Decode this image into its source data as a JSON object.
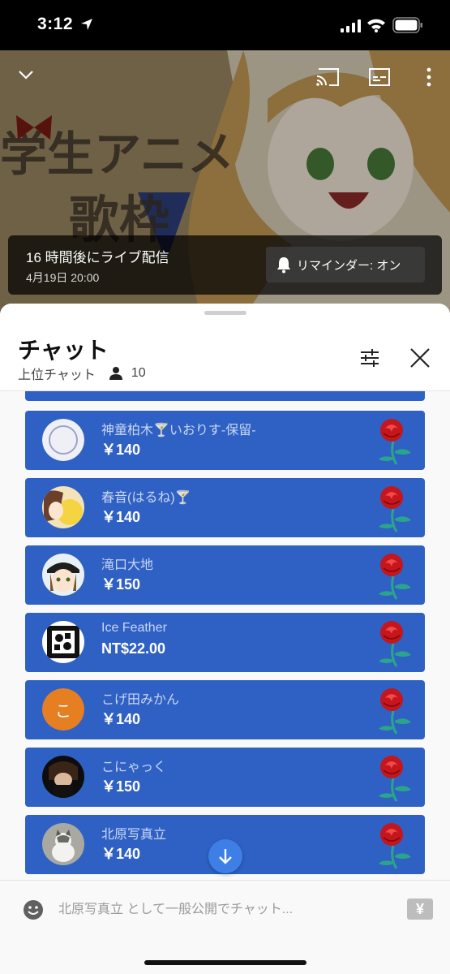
{
  "status_bar": {
    "time": "3:12"
  },
  "video": {
    "live_title": "16 時間後にライブ配信",
    "live_date": "4月19日 20:00",
    "reminder_label": "リマインダー: オン"
  },
  "chat": {
    "title": "チャット",
    "mode": "上位チャット",
    "viewer_count": "10",
    "input_placeholder": "北原写真立 として一般公開でチャット...",
    "superchat_symbol": "¥",
    "messages": [
      {
        "name": "神童柏木🍸いおりす-保留-",
        "amount": "￥140",
        "avatar": "emblem-avatar"
      },
      {
        "name": "春音(はるね)🍸",
        "amount": "￥140",
        "avatar": "anime-girl-avatar"
      },
      {
        "name": "滝口大地",
        "amount": "￥150",
        "avatar": "cap-girl-avatar"
      },
      {
        "name": "Ice Feather",
        "amount": "NT$22.00",
        "avatar": "pattern-avatar"
      },
      {
        "name": "こげ田みかん",
        "amount": "￥140",
        "avatar_letter": "こ"
      },
      {
        "name": "こにゃっく",
        "amount": "￥150",
        "avatar": "dark-hair-avatar"
      },
      {
        "name": "北原写真立",
        "amount": "￥140",
        "avatar": "cat-avatar"
      }
    ]
  },
  "colors": {
    "card_bg": "#2f61c4",
    "accent": "#3d7fe6",
    "letter_avatar": "#e67e22",
    "rose": "#c4161c",
    "stem": "#2aa58a"
  }
}
